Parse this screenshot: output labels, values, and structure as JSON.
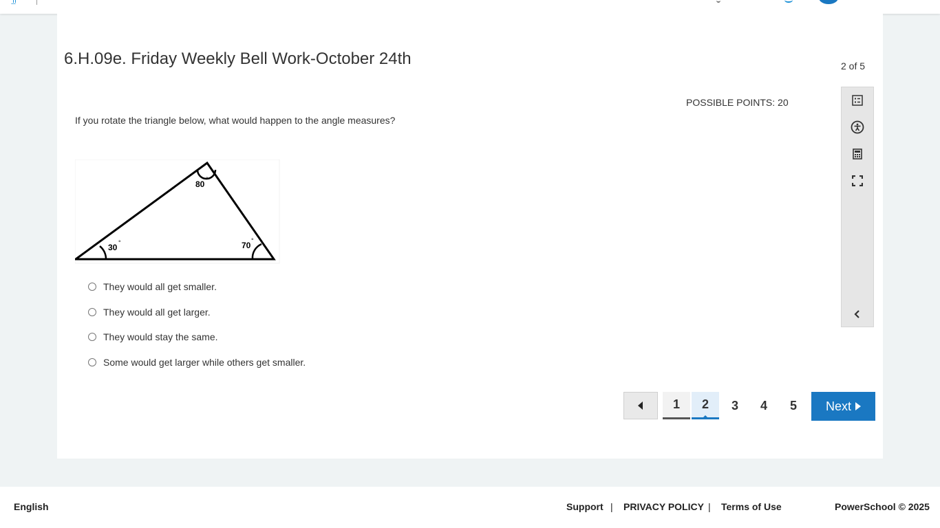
{
  "assignment": {
    "title": "6.H.09e. Friday Weekly Bell Work-October 24th",
    "counter": "2 of 5"
  },
  "question": {
    "points": "POSSIBLE POINTS: 20",
    "prompt": "If you rotate the triangle below, what would happen to the angle measures?",
    "figure": {
      "angle_top": "80",
      "angle_left": "30",
      "angle_right": "70",
      "degree_mark": "°"
    },
    "choices": [
      {
        "label": "They would all get smaller."
      },
      {
        "label": "They would all get larger."
      },
      {
        "label": "They would stay the same."
      },
      {
        "label": "Some would get larger while others get smaller."
      }
    ]
  },
  "tools": [
    {
      "icon": "question-list-icon"
    },
    {
      "icon": "accessibility-icon"
    },
    {
      "icon": "calculator-icon"
    },
    {
      "icon": "fullscreen-icon"
    },
    {
      "icon": "collapse-chevron-left-icon"
    }
  ],
  "pager": {
    "pages": [
      "1",
      "2",
      "3",
      "4",
      "5"
    ],
    "current_page": "2",
    "next_label": "Next"
  },
  "footer": {
    "language": "English",
    "support": "Support",
    "separator": "|",
    "privacy": "PRIVACY POLICY",
    "terms": "Terms of Use",
    "copyright": "PowerSchool © 2025"
  },
  "colors": {
    "accent": "#1a78c2",
    "background": "#eff3f4"
  }
}
